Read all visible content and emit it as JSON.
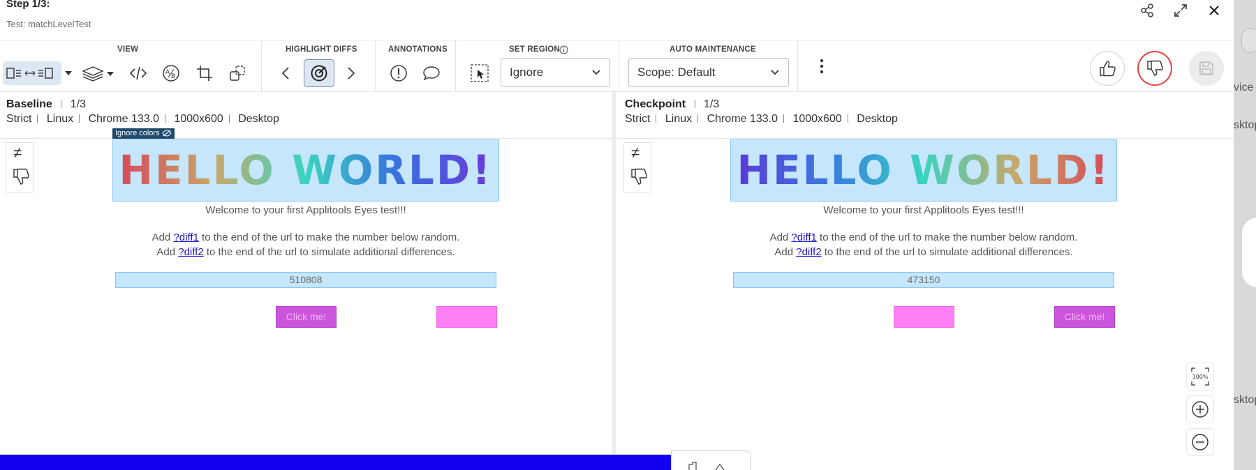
{
  "header": {
    "step_title": "Step 1/3:",
    "test_name": "Test: matchLevelTest",
    "share_icon": "share-icon",
    "expand_icon": "expand-icon",
    "close_icon": "close-icon"
  },
  "toolbar": {
    "view_label": "VIEW",
    "highlight_label": "HIGHLIGHT DIFFS",
    "annotations_label": "ANNOTATIONS",
    "set_region_label": "SET REGION",
    "auto_maintenance_label": "AUTO MAINTENANCE",
    "region_dropdown_value": "Ignore",
    "scope_dropdown_value": "Scope: Default"
  },
  "baseline": {
    "title": "Baseline",
    "count": "1/3",
    "meta": [
      "Strict",
      "Linux",
      "Chrome 133.0",
      "1000x600",
      "Desktop"
    ],
    "ignore_tag": "Ignore colors",
    "hello": "HELLO WORLD!",
    "welcome": "Welcome to your first Applitools Eyes test!!!",
    "line1_prefix": "Add ",
    "line1_link": "?diff1",
    "line1_suffix": " to the end of the url to make the number below random.",
    "line2_prefix": "Add ",
    "line2_link": "?diff2",
    "line2_suffix": " to the end of the url to simulate additional differences.",
    "number": "510808",
    "button": "Click me!"
  },
  "checkpoint": {
    "title": "Checkpoint",
    "count": "1/3",
    "meta": [
      "Strict",
      "Linux",
      "Chrome 133.0",
      "1000x600",
      "Desktop"
    ],
    "hello": "HELLO WORLD!",
    "welcome": "Welcome to your first Applitools Eyes test!!!",
    "line1_prefix": "Add ",
    "line1_link": "?diff1",
    "line1_suffix": " to the end of the url to make the number below random.",
    "line2_prefix": "Add ",
    "line2_link": "?diff2",
    "line2_suffix": " to the end of the url to simulate additional differences.",
    "number": "473150",
    "button": "Click me!"
  },
  "side": {
    "not_equal": "≠",
    "shade_texts": [
      "vice",
      "sktop",
      "sktop"
    ]
  },
  "zoom": {
    "fit_label": "100%"
  },
  "colors": {
    "accent_red": "#e21a1a",
    "highlight_blue": "#c5e6fb",
    "button_purple": "#cc55dd",
    "pink": "#ff80f5",
    "bottom_bar": "#1400f0"
  }
}
